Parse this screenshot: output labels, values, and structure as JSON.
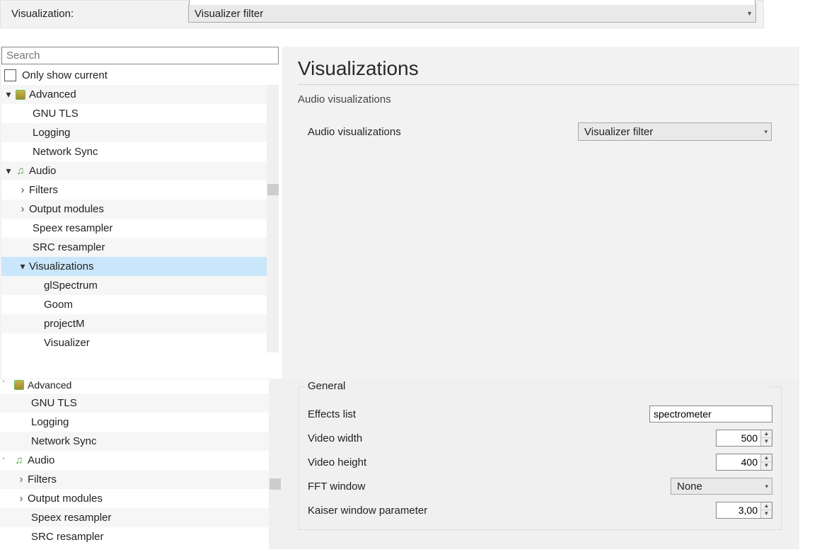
{
  "top": {
    "label": "Visualization:",
    "value": "Visualizer filter"
  },
  "search": {
    "placeholder": "Search"
  },
  "only_show_current": "Only show current",
  "tree1": {
    "advanced": "Advanced",
    "gnu_tls": "GNU TLS",
    "logging": "Logging",
    "network_sync": "Network Sync",
    "audio": "Audio",
    "filters": "Filters",
    "output_modules": "Output modules",
    "speex": "Speex resampler",
    "src": "SRC resampler",
    "visualizations": "Visualizations",
    "glspectrum": "glSpectrum",
    "goom": "Goom",
    "projectm": "projectM",
    "visualizer": "Visualizer"
  },
  "right1": {
    "title": "Visualizations",
    "subtitle": "Audio visualizations",
    "row_label": "Audio visualizations",
    "row_value": "Visualizer filter"
  },
  "tree2": {
    "advanced": "Advanced",
    "gnu_tls": "GNU TLS",
    "logging": "Logging",
    "network_sync": "Network Sync",
    "audio": "Audio",
    "filters": "Filters",
    "output_modules": "Output modules",
    "speex": "Speex resampler",
    "src": "SRC resampler"
  },
  "form": {
    "legend": "General",
    "effects_list_label": "Effects list",
    "effects_list_value": "spectrometer",
    "video_width_label": "Video width",
    "video_width_value": "500",
    "video_height_label": "Video height",
    "video_height_value": "400",
    "fft_window_label": "FFT window",
    "fft_window_value": "None",
    "kaiser_label": "Kaiser window parameter",
    "kaiser_value": "3,00"
  }
}
